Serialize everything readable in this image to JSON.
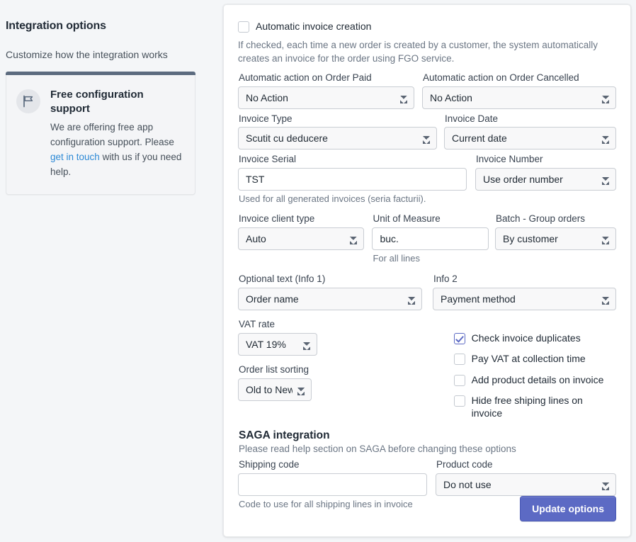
{
  "sidebar": {
    "title": "Integration options",
    "subtitle": "Customize how the integration works",
    "help_card": {
      "icon": "flag-icon",
      "title": "Free configuration support",
      "text_before_link": "We are offering free app configuration support. Please ",
      "link_text": "get in touch",
      "text_after_link": " with us if you need help."
    }
  },
  "form": {
    "auto_invoice": {
      "label": "Automatic invoice creation",
      "checked": false,
      "description": "If checked, each time a new order is created by a customer, the system automatically creates an invoice for the order using FGO service."
    },
    "order_paid": {
      "label": "Automatic action on Order Paid",
      "value": "No Action"
    },
    "order_cancelled": {
      "label": "Automatic action on Order Cancelled",
      "value": "No Action"
    },
    "invoice_type": {
      "label": "Invoice Type",
      "value": "Scutit cu deducere"
    },
    "invoice_date": {
      "label": "Invoice Date",
      "value": "Current date"
    },
    "invoice_serial": {
      "label": "Invoice Serial",
      "value": "TST",
      "helper": "Used for all generated invoices (seria facturii)."
    },
    "invoice_number": {
      "label": "Invoice Number",
      "value": "Use order number"
    },
    "client_type": {
      "label": "Invoice client type",
      "value": "Auto"
    },
    "unit_of_measure": {
      "label": "Unit of Measure",
      "value": "buc.",
      "helper": "For all lines"
    },
    "batch_group": {
      "label": "Batch - Group orders",
      "value": "By customer"
    },
    "info1": {
      "label": "Optional text (Info 1)",
      "value": "Order name"
    },
    "info2": {
      "label": "Info 2",
      "value": "Payment method"
    },
    "vat_rate": {
      "label": "VAT rate",
      "value": "VAT 19%"
    },
    "order_sorting": {
      "label": "Order list sorting",
      "value": "Old to New"
    },
    "checkboxes": [
      {
        "label": "Check invoice duplicates",
        "checked": true
      },
      {
        "label": "Pay VAT at collection time",
        "checked": false
      },
      {
        "label": "Add product details on invoice",
        "checked": false
      },
      {
        "label": "Hide free shiping lines on invoice",
        "checked": false
      }
    ],
    "saga": {
      "title": "SAGA integration",
      "subtitle": "Please read help section on SAGA before changing these options",
      "shipping_code": {
        "label": "Shipping code",
        "value": "",
        "placeholder": "",
        "helper": "Code to use for all shipping lines in invoice"
      },
      "product_code": {
        "label": "Product code",
        "value": "Do not use"
      }
    },
    "submit_label": "Update options"
  },
  "colors": {
    "accent": "#5c6ac4",
    "link": "#2e8ad6",
    "card_topbar": "#5c6b7f",
    "page_bg": "#f4f6f8"
  }
}
